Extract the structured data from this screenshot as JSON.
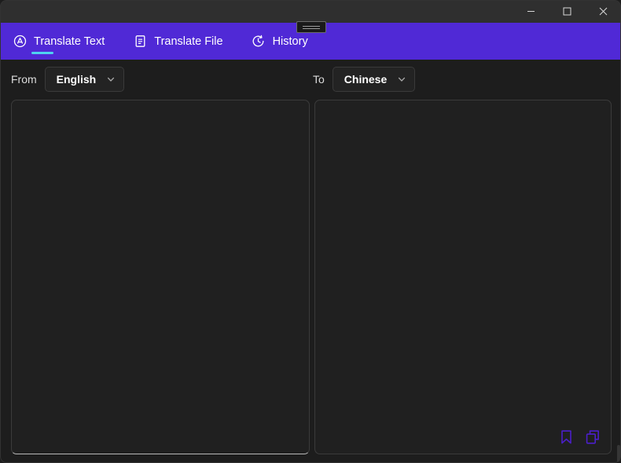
{
  "window": {
    "background_color": "#1d1d1d",
    "titlebar_color": "#2f2f2f",
    "accent_color": "#5029d6",
    "tab_underline_color": "#4fd2f0",
    "icon_purple": "#4b1fc9",
    "controls": {
      "minimize_label": "Minimize",
      "maximize_label": "Maximize",
      "close_label": "Close"
    },
    "drag_handle_label": "Window drag handle"
  },
  "tabs": [
    {
      "id": "translate-text",
      "label": "Translate Text",
      "icon": "translate-globe-icon",
      "active": true
    },
    {
      "id": "translate-file",
      "label": "Translate File",
      "icon": "document-icon",
      "active": false
    },
    {
      "id": "history",
      "label": "History",
      "icon": "clock-history-icon",
      "active": false
    }
  ],
  "language_bar": {
    "from_label": "From",
    "from_value": "English",
    "to_label": "To",
    "to_value": "Chinese",
    "chevron_icon": "chevron-down-icon"
  },
  "panels": {
    "input": {
      "value": "",
      "placeholder": ""
    },
    "output": {
      "value": "",
      "placeholder": "",
      "actions": [
        {
          "id": "bookmark",
          "icon": "bookmark-icon",
          "label": "Bookmark"
        },
        {
          "id": "copy",
          "icon": "copy-icon",
          "label": "Copy"
        }
      ]
    }
  }
}
